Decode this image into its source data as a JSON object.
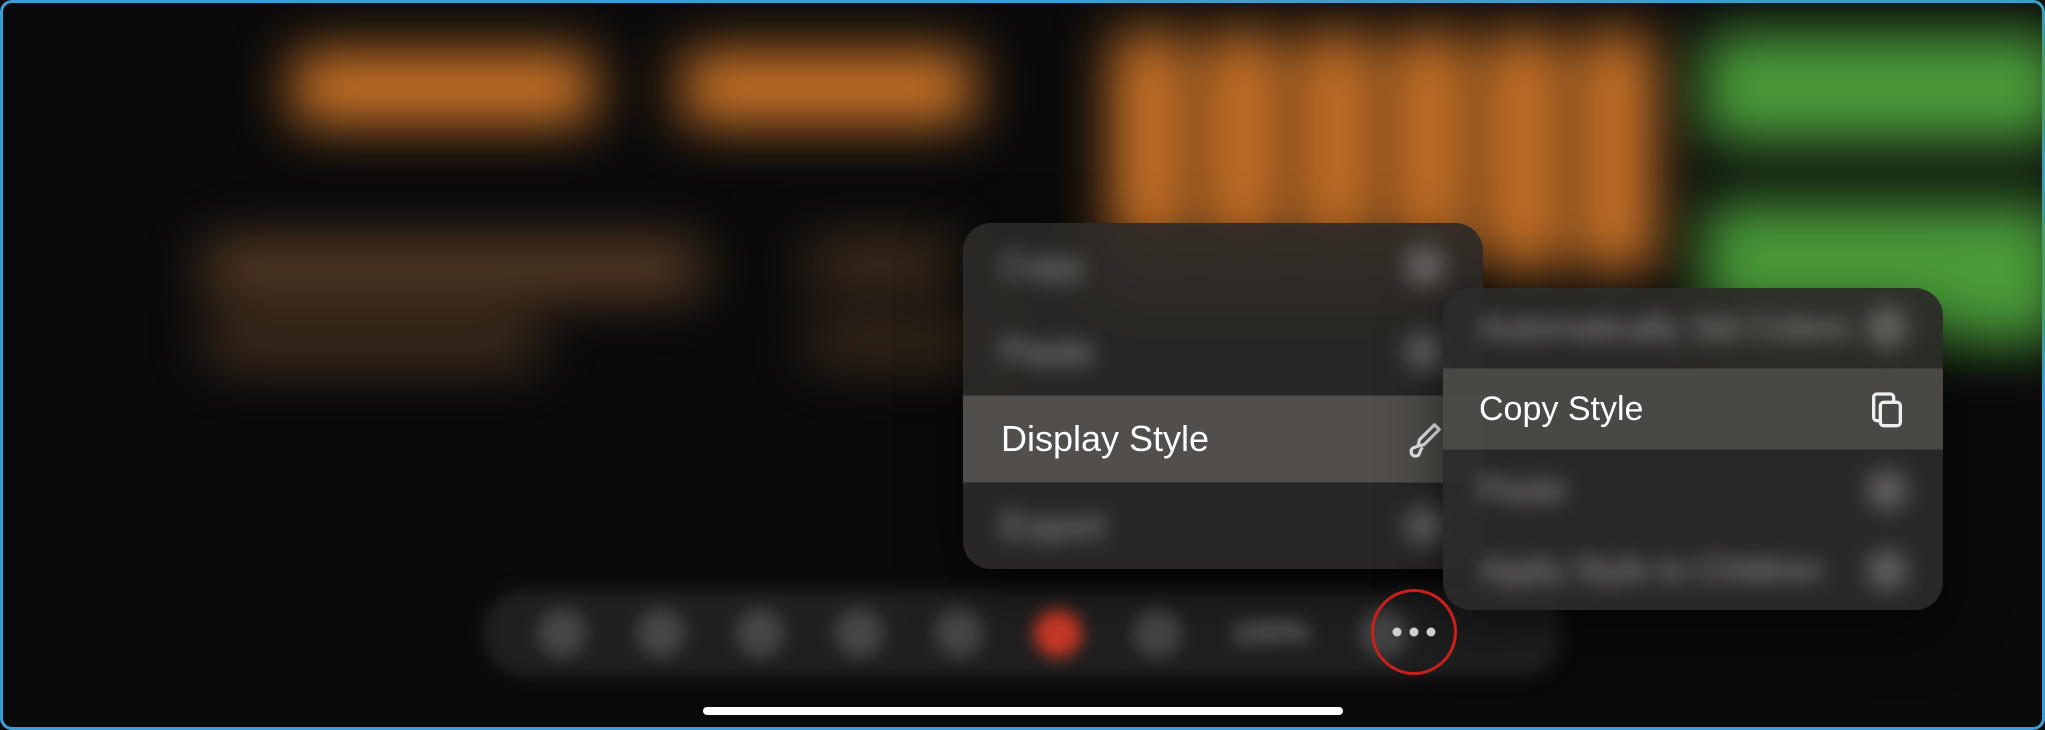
{
  "primary_menu": {
    "items": [
      {
        "label": "Copy",
        "icon": "copy-icon"
      },
      {
        "label": "Paste",
        "icon": "paste-icon"
      },
      {
        "label": "Display Style",
        "icon": "brush-icon",
        "highlighted": true
      },
      {
        "label": "Export",
        "icon": "external-link-icon"
      }
    ]
  },
  "secondary_menu": {
    "items": [
      {
        "label": "Automatically Set Colors",
        "icon": "sparkle-icon"
      },
      {
        "label": "Copy Style",
        "icon": "copy-icon",
        "highlighted": true
      },
      {
        "label": "Paste",
        "icon": "paste-icon"
      },
      {
        "label": "Apply Style to Children",
        "icon": "arrow-down-icon"
      }
    ]
  },
  "toolbar": {
    "zoom_label": "100%"
  },
  "annotation": {
    "more_button_circled": true
  }
}
